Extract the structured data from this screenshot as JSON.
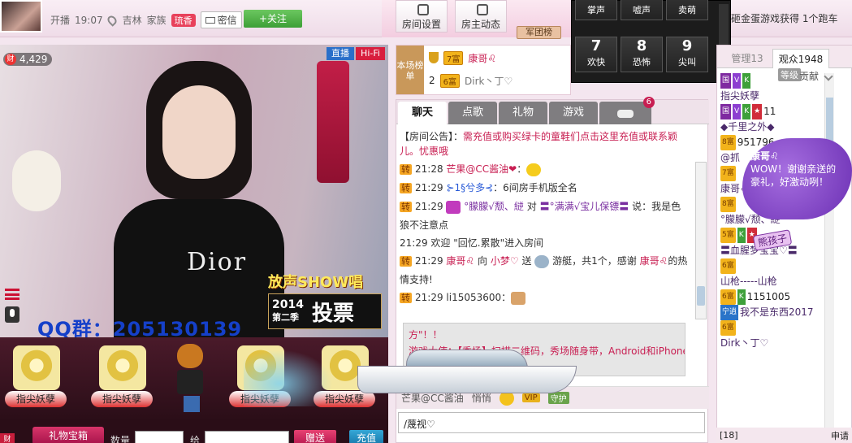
{
  "header": {
    "status": "开播",
    "time": "19:07",
    "location": "吉林",
    "family_label": "家族",
    "family_badge": "琉香",
    "message_button": "密信",
    "follow_button": "+关注",
    "room_settings": "房间设置",
    "host_news": "房主动态",
    "army_rank": "军团榜",
    "marquee": "砸金蛋游戏获得 1个跑车"
  },
  "keypad": [
    {
      "num": "4",
      "label": "掌声"
    },
    {
      "num": "5",
      "label": "嘘声"
    },
    {
      "num": "6",
      "label": "卖萌"
    },
    {
      "num": "7",
      "label": "欢快"
    },
    {
      "num": "8",
      "label": "恐怖"
    },
    {
      "num": "9",
      "label": "尖叫"
    }
  ],
  "video": {
    "wealth_icon": "财",
    "wealth_value": "4,429",
    "live_tag": "直播",
    "hifi_tag": "Hi-Fi",
    "shirt_text": "Dior",
    "qq_group": "QQ群：205130139",
    "show_title": "放声SHOW唱",
    "show_year": "2014",
    "show_season": "第二季",
    "show_vote": "投票"
  },
  "gifts": [
    {
      "label": "指尖妖孽"
    },
    {
      "label": "指尖妖孽"
    },
    {
      "label": "指尖妖孽"
    },
    {
      "label": "指尖妖孽"
    }
  ],
  "bottom_bar": {
    "wealth_small": "财",
    "gift_box_button": "礼物宝箱",
    "quantity_label": "数量",
    "give_label": "给",
    "send_button": "赠送",
    "recharge_button": "充值"
  },
  "ranking": {
    "side_label": "本场榜单",
    "rows": [
      {
        "rank": "1",
        "level": "7富",
        "name": "康哥♌"
      },
      {
        "rank": "2",
        "level": "6富",
        "name": "Dirk丶丁♡"
      }
    ]
  },
  "chat": {
    "tabs": [
      "聊天",
      "点歌",
      "礼物",
      "游戏"
    ],
    "car_badge": "6",
    "announcement_prefix": "【房间公告】：",
    "announcement_text": "需充值或购买绿卡的童鞋们点击这里充值或联系颖儿。忧惠哦",
    "zhuan": "转",
    "messages": [
      {
        "time": "21:28",
        "user": "芒果@CC酱油❤",
        "text": "："
      },
      {
        "time": "21:29",
        "user": "⊱1§兮多⊰",
        "text": "：6间房手机版全名"
      },
      {
        "time": "21:29",
        "user": "°朦朦√颓、縌",
        "text": "对",
        "user2": "〓°满满√宝儿保镖〓",
        "text2": "说：我是色狼不注意点"
      },
      {
        "time": "21:29",
        "text": "欢迎 \"回忆.累散\"进入房间"
      },
      {
        "time": "21:29",
        "user": "康哥♌",
        "text": "向",
        "user2": "小梦♡",
        "text2": "送",
        "text3": "游艇，共1个，感谢",
        "user3": "康哥♌",
        "text4": "的热情支持!"
      },
      {
        "time": "21:29",
        "user": "li15053600",
        "text": "："
      }
    ],
    "private_lines": [
      "方\"！！",
      "游戏大使：【秀场】扫描二维码，秀场随身带，Android和iPhone"
    ],
    "toolbar": {
      "target": "芒果@CC酱油",
      "dropdown": "悄悄",
      "vip": "VIP",
      "private": "守护"
    },
    "input_value": "/蔑视♡"
  },
  "right_panel": {
    "tabs": [
      "管理13",
      "观众1948"
    ],
    "grade_label": "等级",
    "contrib_label": "贡献",
    "users": [
      {
        "badges": [
          "国",
          "V",
          "K"
        ],
        "name": ""
      },
      {
        "badges": [],
        "name": "指尖妖孽"
      },
      {
        "badges": [
          "国",
          "V",
          "K",
          "★"
        ],
        "name": "11"
      },
      {
        "badges": [],
        "name": "◆千里之外◆"
      },
      {
        "badges": [
          "8富"
        ],
        "name": "951796"
      },
      {
        "badges": [],
        "name": "@抓"
      },
      {
        "badges": [
          "7富"
        ],
        "name": ""
      },
      {
        "badges": [],
        "name": "康哥♌"
      },
      {
        "badges": [
          "8富"
        ],
        "name": ""
      },
      {
        "badges": [],
        "name": "°朦朦√颓、縌"
      },
      {
        "badges": [
          "5富",
          "K",
          "★"
        ],
        "name": ""
      },
      {
        "badges": [],
        "name": "〓血腥梦宝宝♡〓"
      },
      {
        "badges": [
          "6富"
        ],
        "name": ""
      },
      {
        "badges": [],
        "name": "山枪-----山枪"
      },
      {
        "badges": [
          "6富",
          "K"
        ],
        "name": "1151005"
      },
      {
        "badges": [
          "宁逍"
        ],
        "name": "我不是东西2017"
      },
      {
        "badges": [
          "6富"
        ],
        "name": ""
      },
      {
        "badges": [],
        "name": "Dirk丶丁♡"
      }
    ],
    "bubble_name": "康哥♌",
    "bubble_text": "WOW！谢谢亲送的豪礼，好激动咧！",
    "sticker_text": "熊孩子",
    "bottom_count": "[18]",
    "bottom_apply": "申请"
  }
}
